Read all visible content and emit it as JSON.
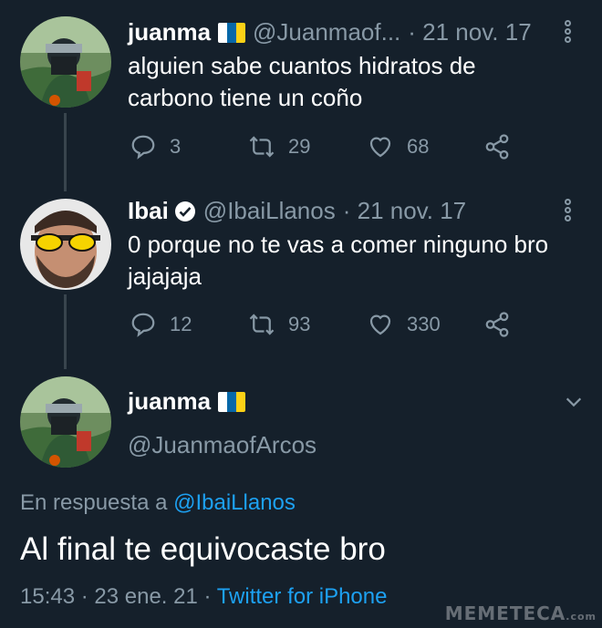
{
  "colors": {
    "background": "#15202b",
    "muted": "#8899a6",
    "link": "#1da1f2",
    "divider": "#38444d"
  },
  "tweet1": {
    "name": "juanma",
    "flag_icon": "canary-islands-flag-icon",
    "handle": "@Juanmaof...",
    "date": "· 21 nov. 17",
    "text_line1": "alguien sabe cuantos hidratos de",
    "text_line2": "carbono tiene un coño",
    "replies": "3",
    "retweets": "29",
    "likes": "68"
  },
  "tweet2": {
    "name": "Ibai",
    "handle": "@IbaiLlanos",
    "date": "· 21 nov. 17",
    "text_line1": "0 porque no te vas a comer ninguno bro",
    "text_line2": "jajajaja",
    "replies": "12",
    "retweets": "93",
    "likes": "330"
  },
  "main_tweet": {
    "name": "juanma",
    "handle": "@JuanmaofArcos",
    "reply_prefix": "En respuesta a",
    "reply_to": "@IbaiLlanos",
    "text": "Al final te equivocaste bro",
    "time": "15:43 · 23 ene. 21 ·",
    "client": "Twitter for iPhone"
  },
  "watermark": {
    "text": "MEMETECA",
    "suffix": ".com"
  }
}
